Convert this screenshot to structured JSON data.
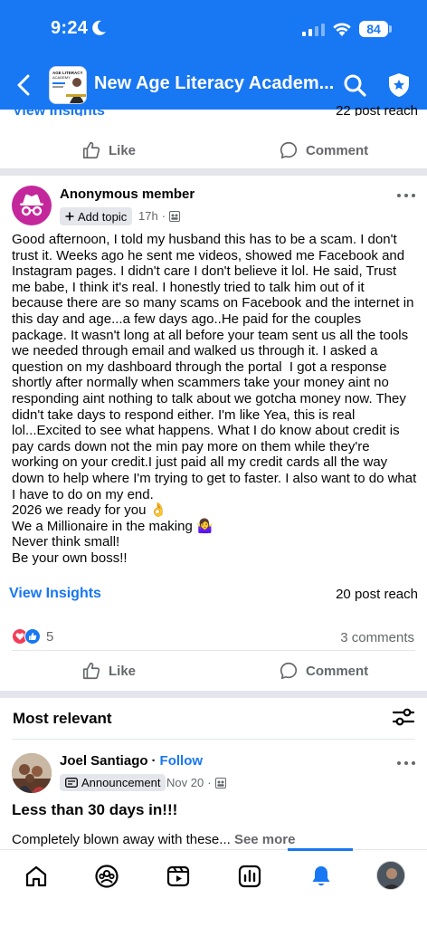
{
  "status_bar": {
    "time": "9:24",
    "battery": "84"
  },
  "header": {
    "group_title": "New Age Literacy Academ...",
    "thumb_line1": "AGE LITERACY",
    "thumb_line2": "ACADEMY"
  },
  "prev_post": {
    "insights_label": "View Insights",
    "reach": "22 post reach",
    "like_label": "Like",
    "comment_label": "Comment"
  },
  "post": {
    "author": "Anonymous member",
    "topic_chip": "Add topic",
    "time": "17h",
    "body": "Good afternoon, I told my husband this has to be a scam. I don't trust it. Weeks ago he sent me videos, showed me Facebook and Instagram pages. I didn't care I don't believe it lol. He said, Trust me babe, I think it's real. I honestly tried to talk him out of it because there are so many scams on Facebook and the internet in this day and age...a few days ago..He paid for the couples package. It wasn't long at all before your team sent us all the tools we needed through email and walked us through it. I asked a question on my dashboard through the portal  I got a response shortly after normally when scammers take your money aint no responding aint nothing to talk about we gotcha money now. They didn't take days to respond either. I'm like Yea, this is real lol...Excited to see what happens. What I do know about credit is pay cards down not the min pay more on them while they're working on your credit.I just paid all my credit cards all the way down to help where I'm trying to get to faster. I also want to do what I have to do on my end.\n2026 we ready for you 👌\nWe a Millionaire in the making 🤷‍♀️\nNever think small!\nBe your own boss!!",
    "insights_label": "View Insights",
    "reach": "20 post reach",
    "reaction_count": "5",
    "comments": "3 comments",
    "like_label": "Like",
    "comment_label": "Comment"
  },
  "comments_section": {
    "sort_label": "Most relevant"
  },
  "next_post": {
    "author": "Joel Santiago",
    "separator": "·",
    "follow": "Follow",
    "chip": "Announcement",
    "date": "Nov 20",
    "title": "Less than 30 days in!!!",
    "preview": "Completely blown away with these...",
    "see_more": "See more"
  },
  "colors": {
    "brand": "#1877f2",
    "anon_avatar": "#c4279b",
    "muted": "#65676b",
    "separator": "#e4e6eb"
  },
  "bottom_nav": {
    "items": [
      "home-icon",
      "groups-icon",
      "video-icon",
      "insights-icon",
      "notifications-icon",
      "profile-avatar"
    ],
    "active": "notifications-icon"
  }
}
